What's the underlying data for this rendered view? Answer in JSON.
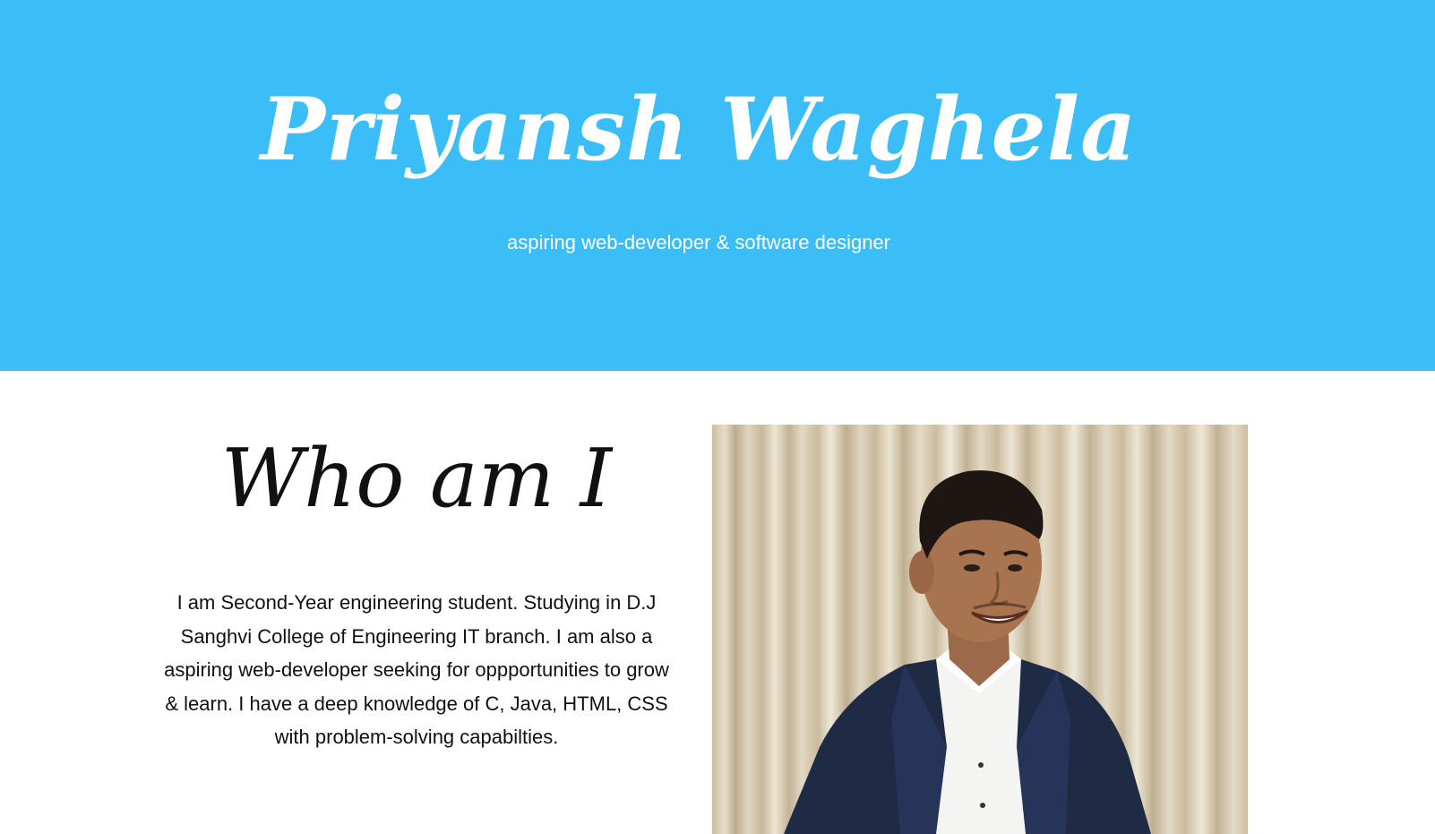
{
  "hero": {
    "name": "Priyansh Waghela",
    "tagline": "aspiring web-developer & software designer",
    "background_color": "#3bbdf8"
  },
  "about": {
    "heading": "Who am I",
    "text": "I am Second-Year engineering student. Studying in D.J Sanghvi College of Engineering IT branch. I am also a aspiring web-developer seeking for oppportunities to grow & learn. I have a deep knowledge of C, Java, HTML, CSS with problem-solving capabilties."
  }
}
